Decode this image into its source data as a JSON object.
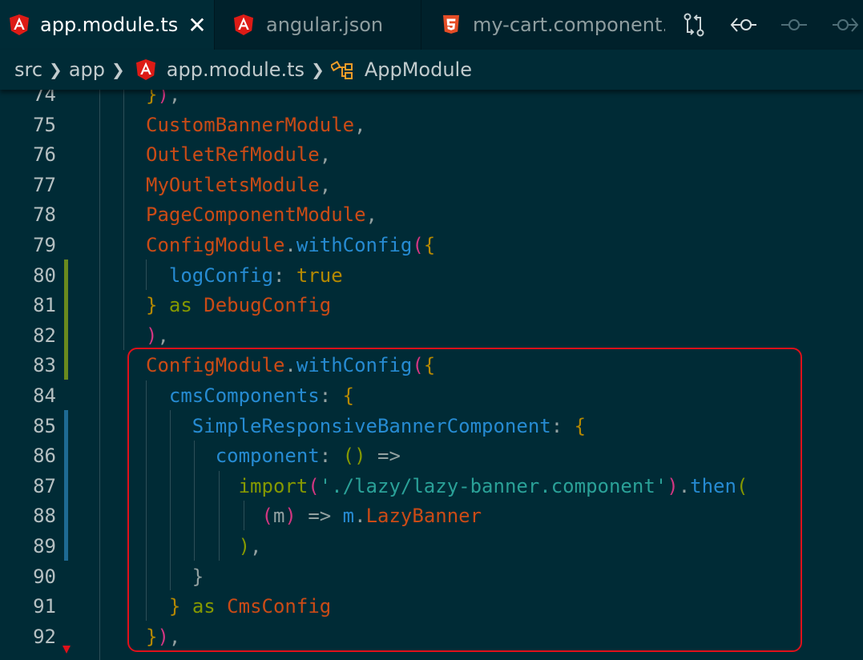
{
  "tabs": [
    {
      "label": "app.module.ts",
      "icon": "angular-icon",
      "active": true,
      "close": "✕"
    },
    {
      "label": "angular.json",
      "icon": "angular-icon",
      "active": false
    },
    {
      "label": "my-cart.component.h",
      "icon": "html5-icon",
      "active": false
    }
  ],
  "toolbar": [
    "compare-changes-icon",
    "go-back-icon",
    "previous-change-icon",
    "next-change-icon"
  ],
  "breadcrumb": {
    "items": [
      "src",
      "app",
      "app.module.ts",
      "AppModule"
    ]
  },
  "colors": {
    "editor_bg": "#002b36",
    "tabbar_bg": "#00212b",
    "class": "#cb4b16",
    "property": "#268bd2",
    "keyword": "#859900",
    "string": "#2aa198",
    "boolean": "#b58900",
    "highlight_border": "#e0101a"
  },
  "editor": {
    "lines": [
      {
        "num": "74",
        "text": "}),"
      },
      {
        "num": "75",
        "text": "CustomBannerModule,"
      },
      {
        "num": "76",
        "text": "OutletRefModule,"
      },
      {
        "num": "77",
        "text": "MyOutletsModule,"
      },
      {
        "num": "78",
        "text": "PageComponentModule,"
      },
      {
        "num": "79",
        "text": "ConfigModule.withConfig({"
      },
      {
        "num": "80",
        "text": "  logConfig: true"
      },
      {
        "num": "81",
        "text": "} as DebugConfig"
      },
      {
        "num": "82",
        "text": "),"
      },
      {
        "num": "83",
        "text": "ConfigModule.withConfig({"
      },
      {
        "num": "84",
        "text": "  cmsComponents: {"
      },
      {
        "num": "85",
        "text": "    SimpleResponsiveBannerComponent: {"
      },
      {
        "num": "86",
        "text": "      component: () =>"
      },
      {
        "num": "87",
        "text": "        import('./lazy/lazy-banner.component').then("
      },
      {
        "num": "88",
        "text": "          (m) => m.LazyBanner"
      },
      {
        "num": "89",
        "text": "        ),"
      },
      {
        "num": "90",
        "text": "    }"
      },
      {
        "num": "91",
        "text": "  } as CmsConfig"
      },
      {
        "num": "92",
        "text": "}),"
      }
    ]
  }
}
